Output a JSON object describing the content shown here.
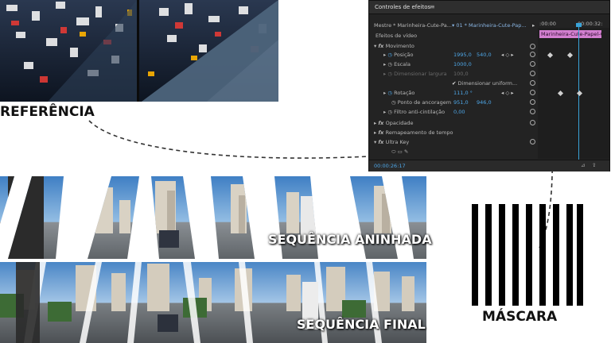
{
  "labels": {
    "referencia": "REFERÊNCIA",
    "sequencia_aninhada": "SEQUÊNCIA ANINHADA",
    "sequencia_final": "SEQUÊNCIA FINAL",
    "mascara": "MÁSCARA"
  },
  "panel": {
    "title": "Controles de efeitos",
    "menu_icon": "≡",
    "master_clip": "Mestre * Marinheira-Cute-Pa...",
    "sequence_clip": "01 * Marinheira-Cute-Pap...",
    "time_start": ":00:00",
    "time_end": "00:00:32:",
    "timeline_clip": "Marinheira-Cute-Papel-O",
    "section_video": "Efeitos de vídeo",
    "movimento": "Movimento",
    "posicao_label": "Posição",
    "posicao_x": "1995,0",
    "posicao_y": "540,0",
    "escala_label": "Escala",
    "escala_value": "1000,0",
    "escala_largura_label": "Dimensionar largura",
    "escala_largura_value": "100,0",
    "uniforme_label": "Dimensionar uniform...",
    "rotacao_label": "Rotação",
    "rotacao_value": "111,0 °",
    "ancoragem_label": "Ponto de ancoragem",
    "ancoragem_x": "951,0",
    "ancoragem_y": "946,0",
    "filtro_label": "Filtro anti-cintilação",
    "filtro_value": "0,00",
    "opacidade": "Opacidade",
    "remapeamento": "Remapeamento de tempo",
    "ultra_key": "Ultra Key",
    "timecode": "00:00:26:17"
  },
  "colors": {
    "panel_bg": "#232323",
    "accent_blue": "#4ea7e8",
    "clip_pink": "#d37fd0",
    "playhead": "#39a3d8"
  },
  "icons": [
    "fx-icon",
    "stopwatch-icon",
    "reset-icon",
    "keyframe-icon",
    "chevron-right-icon",
    "chevron-down-icon",
    "ellipse-mask-icon",
    "rectangle-mask-icon",
    "pen-mask-icon",
    "export-icon",
    "filter-icon"
  ]
}
